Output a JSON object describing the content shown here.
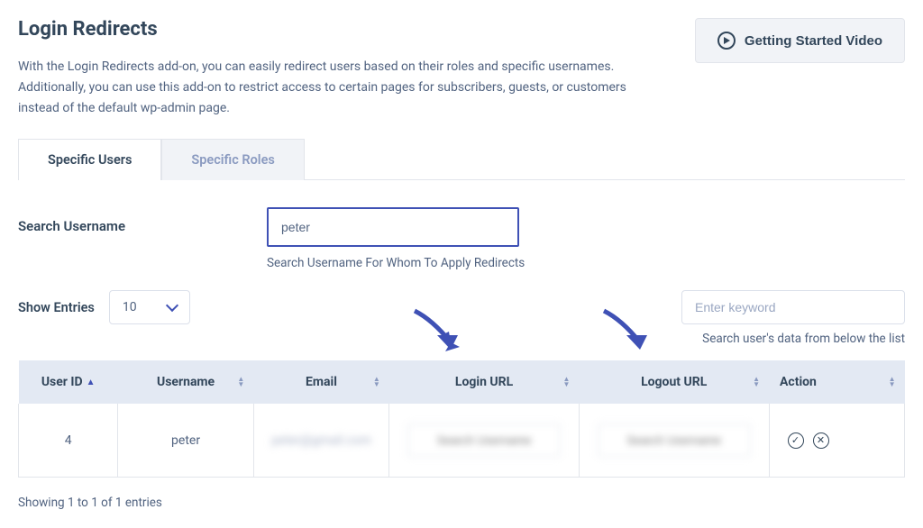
{
  "header": {
    "title": "Login Redirects",
    "description": "With the Login Redirects add-on, you can easily redirect users based on their roles and specific usernames. Additionally, you can use this add-on to restrict access to certain pages for subscribers, guests, or customers instead of the default wp-admin page.",
    "gs_button": "Getting Started Video"
  },
  "tabs": {
    "users": "Specific Users",
    "roles": "Specific Roles"
  },
  "search": {
    "label": "Search Username",
    "value": "peter",
    "help": "Search Username For Whom To Apply Redirects"
  },
  "entries": {
    "label": "Show Entries",
    "value": "10"
  },
  "keyword": {
    "placeholder": "Enter keyword",
    "help": "Search user's data from below the list"
  },
  "table": {
    "headers": {
      "user_id": "User ID",
      "username": "Username",
      "email": "Email",
      "login_url": "Login URL",
      "logout_url": "Logout URL",
      "action": "Action"
    },
    "rows": [
      {
        "user_id": "4",
        "username": "peter",
        "email": "peter@gmail.com",
        "login_url_placeholder": "Search Username",
        "logout_url_placeholder": "Search Username"
      }
    ]
  },
  "pagination": "Showing 1 to 1 of 1 entries"
}
